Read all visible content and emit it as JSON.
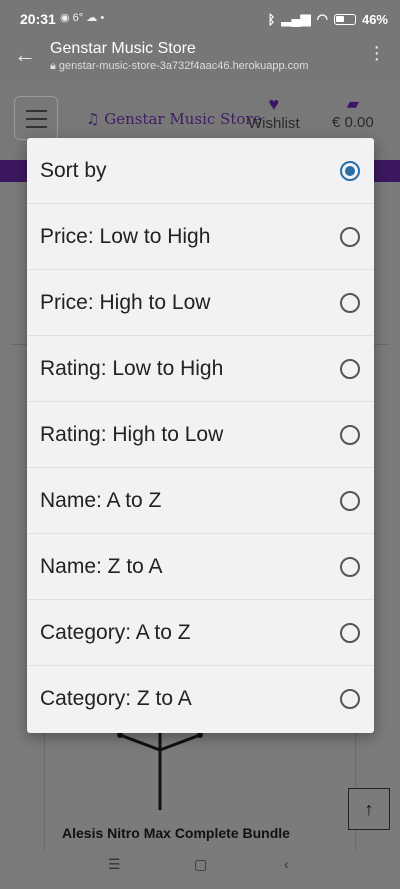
{
  "status_bar": {
    "time": "20:31",
    "temperature": "6°",
    "battery": "46%"
  },
  "browser": {
    "title": "Genstar Music Store",
    "url": "genstar-music-store-3a732f4aac46.herokuapp.com"
  },
  "header": {
    "brand": "Genstar Music Store",
    "wishlist_label": "Wishlist",
    "cart_total": "€ 0.00"
  },
  "product": {
    "name": "Alesis Nitro Max Complete Bundle"
  },
  "sort_dialog": {
    "options": [
      {
        "label": "Sort by",
        "selected": true
      },
      {
        "label": "Price: Low to High",
        "selected": false
      },
      {
        "label": "Price: High to Low",
        "selected": false
      },
      {
        "label": "Rating: Low to High",
        "selected": false
      },
      {
        "label": "Rating: High to Low",
        "selected": false
      },
      {
        "label": "Name: A to Z",
        "selected": false
      },
      {
        "label": "Name: Z to A",
        "selected": false
      },
      {
        "label": "Category: A to Z",
        "selected": false
      },
      {
        "label": "Category: Z to A",
        "selected": false
      }
    ]
  },
  "icons": {
    "back": "arrow-left-icon",
    "lock": "lock-icon",
    "menu": "more-vert-icon",
    "hamburger": "hamburger-icon",
    "music_note": "music-note-icon",
    "heart": "heart-icon",
    "bag": "shopping-bag-icon",
    "scroll_top": "arrow-up-icon"
  },
  "colors": {
    "brand_purple": "#3b185f",
    "radio_selected": "#2a6ea8"
  }
}
